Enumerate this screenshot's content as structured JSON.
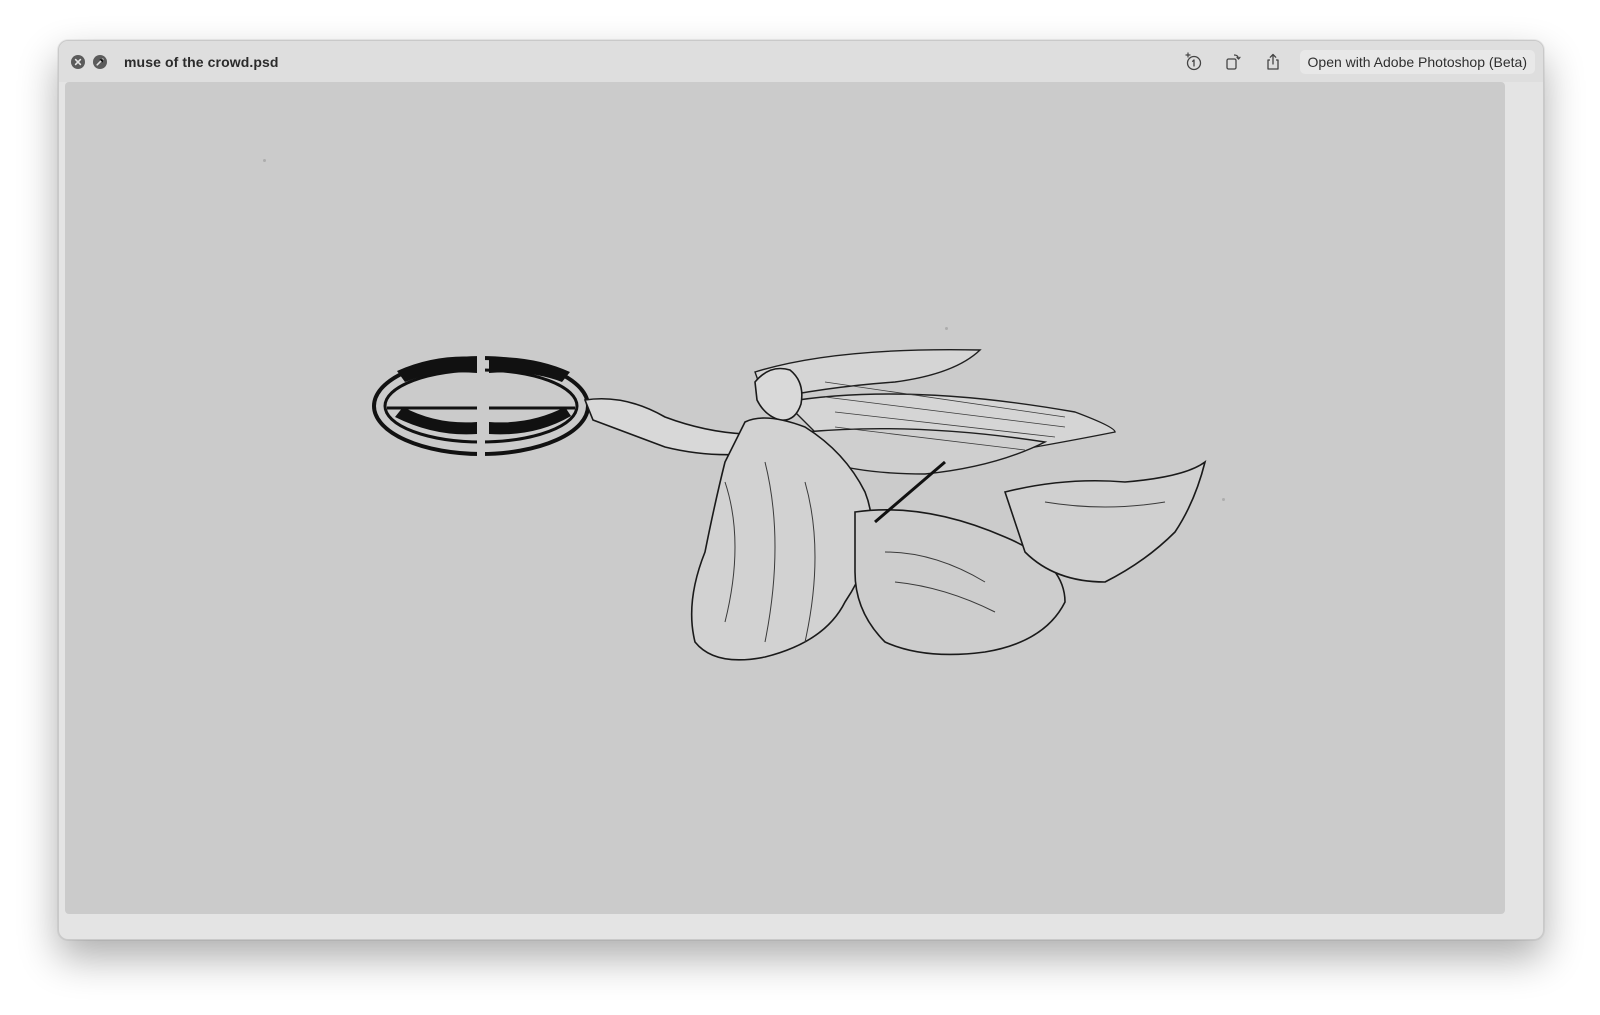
{
  "window": {
    "title": "muse of the crowd.psd",
    "close_icon": "close-icon",
    "fullscreen_icon": "fullscreen-icon"
  },
  "toolbar": {
    "markup_icon": "markup-icon",
    "rotate_icon": "rotate-icon",
    "share_icon": "share-icon",
    "open_with_label": "Open with Adobe Photoshop (Beta)"
  },
  "preview": {
    "background_color": "#cbcbcb",
    "content": "engraving-illustration"
  }
}
